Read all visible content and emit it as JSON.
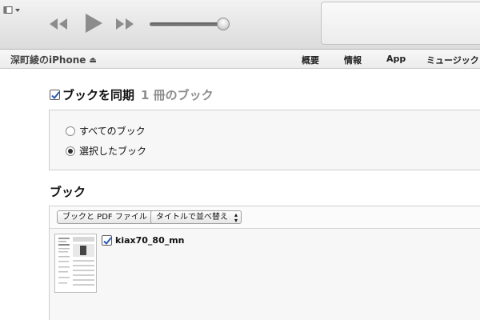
{
  "device": {
    "name": "深町綾のiPhone"
  },
  "nav_tabs": [
    "概要",
    "情報",
    "App",
    "ミュージック"
  ],
  "sync": {
    "checked": true,
    "label": "ブックを同期",
    "count": "1 冊のブック"
  },
  "options": [
    {
      "label": "すべてのブック",
      "selected": false
    },
    {
      "label": "選択したブック",
      "selected": true
    }
  ],
  "books": {
    "heading": "ブック",
    "filter_popup": "ブックと PDF ファイル",
    "sort_popup": "タイトルで並べ替え",
    "items": [
      {
        "title": "kiax70_80_mn",
        "checked": true
      }
    ]
  },
  "volume": 0.92,
  "colors": {
    "check_mark": "#2a5ab8",
    "toolbar_top": "#f2f2f2",
    "toolbar_bottom": "#dcdcdc"
  },
  "icons": [
    "sidebar-toggle-icon",
    "rewind-icon",
    "play-icon",
    "fast-forward-icon",
    "eject-icon",
    "check-icon",
    "up-down-arrows-icon",
    "book-cover-icon"
  ]
}
